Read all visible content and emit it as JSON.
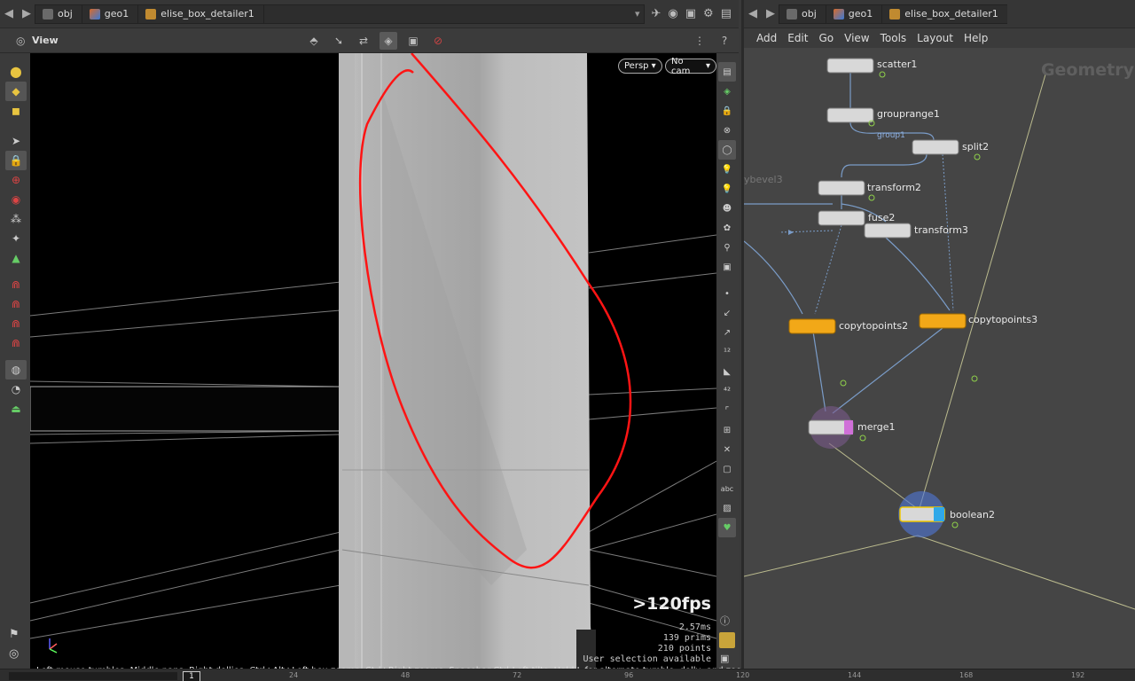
{
  "left_path": {
    "crumbs": [
      {
        "label": "obj",
        "color": "#6a6a6a"
      },
      {
        "label": "geo1",
        "color": "#d86a2a"
      },
      {
        "label": "elise_box_detailer1",
        "color": "#c08a30"
      }
    ]
  },
  "right_path": {
    "crumbs": [
      {
        "label": "obj",
        "color": "#6a6a6a"
      },
      {
        "label": "geo1",
        "color": "#d86a2a"
      },
      {
        "label": "elise_box_detailer1",
        "color": "#c08a30"
      }
    ]
  },
  "viewer": {
    "title": "View",
    "persp_label": "Persp",
    "cam_label": "No cam",
    "fps": ">120fps",
    "stats_lines": [
      "2.57ms",
      "139  prims",
      "210  points",
      "User selection available"
    ],
    "status_text": "Left mouse tumbles. Middle pans. Right dollies. Ctrl+Alt+Left box-zooms. Ctrl+Right zooms. Spacebar-Ctrl-Left tilts. Hold L for alternate tumble, dolly, and zoom."
  },
  "menu": [
    "Add",
    "Edit",
    "Go",
    "View",
    "Tools",
    "Layout",
    "Help"
  ],
  "network": {
    "context_label": "Geometry",
    "nodes": [
      {
        "name": "scatter1"
      },
      {
        "name": "grouprange1"
      },
      {
        "name": "split2"
      },
      {
        "name": "transform2"
      },
      {
        "name": "fuse2"
      },
      {
        "name": "transform3"
      },
      {
        "name": "copytopoints2"
      },
      {
        "name": "copytopoints3"
      },
      {
        "name": "merge1"
      },
      {
        "name": "boolean2"
      }
    ],
    "group_label": "group1",
    "offscreen_label": "ybevel3"
  },
  "timeline": {
    "ticks": [
      "24",
      "48",
      "72",
      "96",
      "120",
      "144",
      "168",
      "192"
    ],
    "current_frame": "1"
  }
}
